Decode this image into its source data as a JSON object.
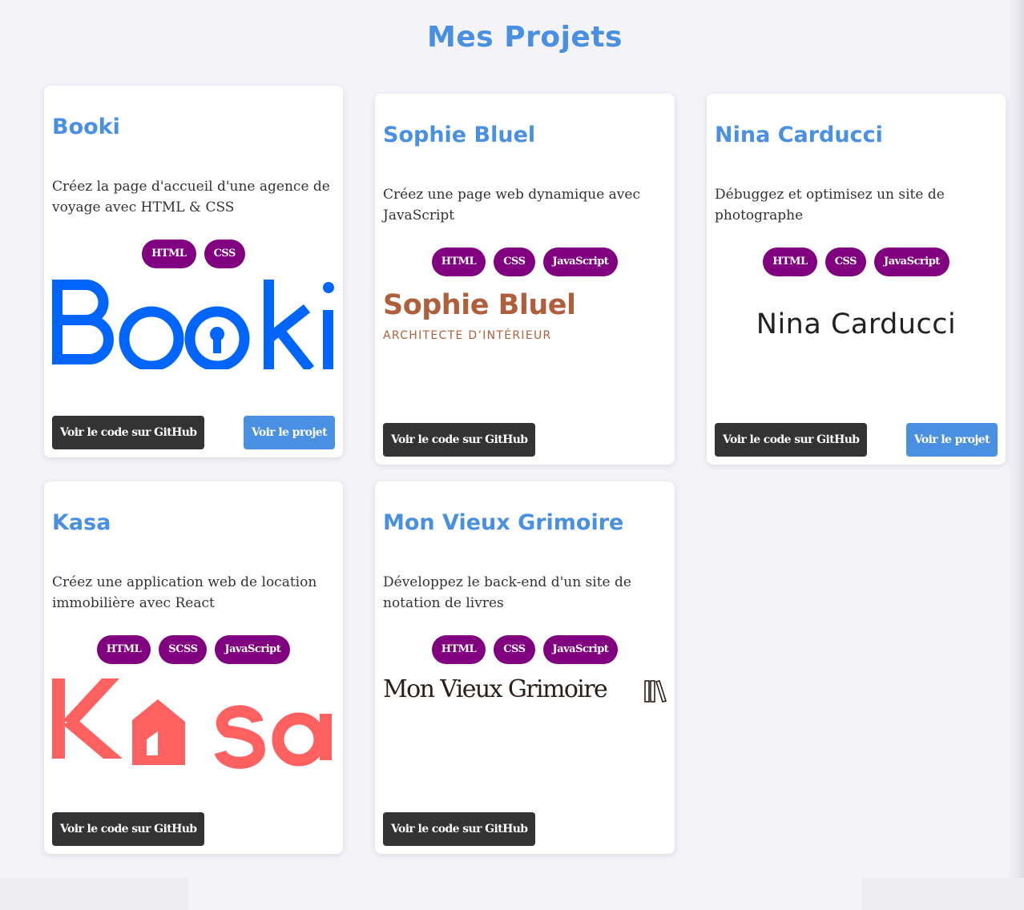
{
  "page": {
    "title": "Mes Projets",
    "accent_color": "#4a90e2",
    "tag_color": "#800080",
    "github_button_color": "#333333"
  },
  "projects": [
    {
      "title": "Booki",
      "description": "Créez la page d'accueil d'une agence de voyage avec HTML & CSS",
      "tags": [
        "HTML",
        "CSS"
      ],
      "logo": "booki-logo",
      "logo_text": "Booki",
      "github_label": "Voir le code sur GitHub",
      "project_label": "Voir le projet"
    },
    {
      "title": "Sophie Bluel",
      "description": "Créez une page web dynamique avec JavaScript",
      "tags": [
        "HTML",
        "CSS",
        "JavaScript"
      ],
      "logo": "sophie-bluel-logo",
      "logo_text": "Sophie Bluel",
      "logo_subtext": "ARCHITECTE D’INTÉRIEUR",
      "github_label": "Voir le code sur GitHub"
    },
    {
      "title": "Nina Carducci",
      "description": "Débuggez et optimisez un site de photographe",
      "tags": [
        "HTML",
        "CSS",
        "JavaScript"
      ],
      "logo": "nina-carducci-logo",
      "logo_text": "Nina Carducci",
      "github_label": "Voir le code sur GitHub",
      "project_label": "Voir le projet"
    },
    {
      "title": "Kasa",
      "description": "Créez une application web de location immobilière avec React",
      "tags": [
        "HTML",
        "SCSS",
        "JavaScript"
      ],
      "logo": "kasa-logo",
      "logo_text": "Kasa",
      "github_label": "Voir le code sur GitHub"
    },
    {
      "title": "Mon Vieux Grimoire",
      "description": "Développez le back-end d'un site de notation de livres",
      "tags": [
        "HTML",
        "CSS",
        "JavaScript"
      ],
      "logo": "mon-vieux-grimoire-logo",
      "logo_text": "Mon Vieux Grimoire",
      "github_label": "Voir le code sur GitHub"
    }
  ]
}
